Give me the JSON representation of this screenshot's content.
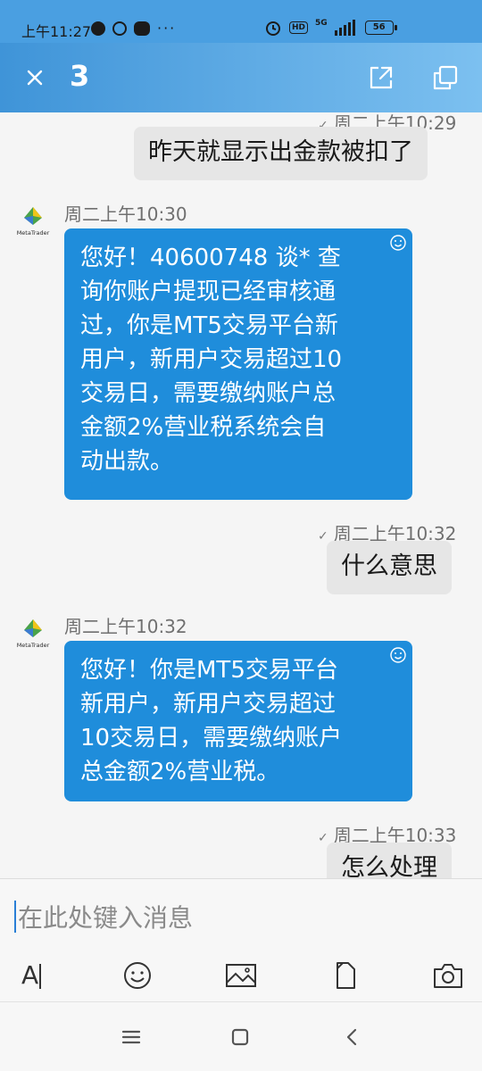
{
  "status_bar": {
    "time": "上午11:27",
    "network": "5G",
    "hd": "HD",
    "battery": "56",
    "more": "···"
  },
  "header": {
    "title": "3",
    "icons": [
      "close-icon",
      "open-external-icon",
      "copy-window-icon"
    ]
  },
  "messages": [
    {
      "direction": "out",
      "time": "周二上午10:29",
      "text": "昨天就显示出金款被扣了"
    },
    {
      "direction": "in",
      "sender": "MetaTrader",
      "time": "周二上午10:30",
      "lines": [
        "您好！40600748 谈* 查",
        "询你账户提现已经审核通",
        "过，你是MT5交易平台新",
        "用户，新用户交易超过10",
        "交易日，需要缴纳账户总",
        "金额2%营业税系统会自",
        "动出款。"
      ]
    },
    {
      "direction": "out",
      "time": "周二上午10:32",
      "text": "什么意思"
    },
    {
      "direction": "in",
      "sender": "MetaTrader",
      "time": "周二上午10:32",
      "lines": [
        "您好！你是MT5交易平台",
        "新用户，新用户交易超过",
        "10交易日，需要缴纳账户",
        "总金额2%营业税。"
      ]
    },
    {
      "direction": "out",
      "time": "周二上午10:33",
      "text": "怎么处理"
    }
  ],
  "avatar_label": "MetaTrader",
  "input": {
    "placeholder": "在此处键入消息"
  },
  "toolbar": {
    "font_label": "A",
    "icons": [
      "text-format-icon",
      "emoji-icon",
      "image-icon",
      "file-icon",
      "camera-icon"
    ]
  },
  "colors": {
    "header_start": "#3f94d8",
    "header_end": "#7cc0f0",
    "bubble_in": "#1f8ddb",
    "bubble_out": "#e6e6e6"
  }
}
